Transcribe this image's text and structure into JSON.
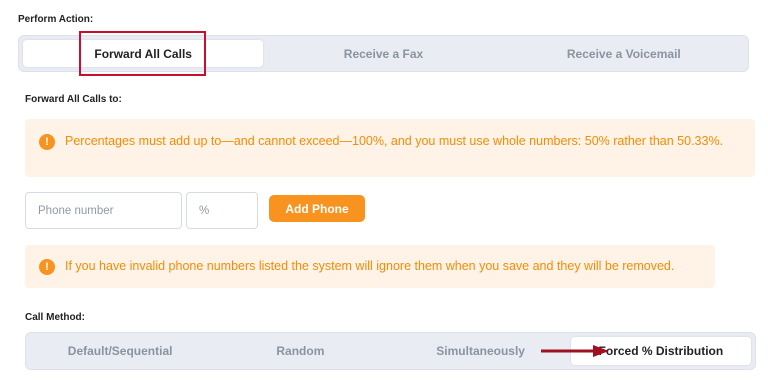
{
  "perform_action": {
    "label": "Perform Action:",
    "options": [
      "Forward All Calls",
      "Receive a Fax",
      "Receive a Voicemail"
    ],
    "selected": "Forward All Calls"
  },
  "forward": {
    "label": "Forward All Calls to:",
    "alert_percent": "Percentages must add up to—and cannot exceed—100%, and you must use whole numbers: 50% rather than 50.33%.",
    "phone_placeholder": "Phone number",
    "percent_placeholder": "%",
    "add_phone_label": "Add Phone",
    "alert_invalid": "If you have invalid phone numbers listed the system will ignore them when you save and they will be removed."
  },
  "call_method": {
    "label": "Call Method:",
    "options": [
      "Default/Sequential",
      "Random",
      "Simultaneously",
      "Forced % Distribution"
    ],
    "selected": "Forced % Distribution"
  },
  "colors": {
    "accent": "#f7931e",
    "highlight": "#c8102e",
    "arrow": "#a01020"
  }
}
